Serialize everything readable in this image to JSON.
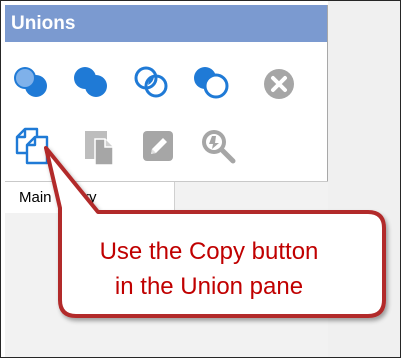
{
  "pane": {
    "title": "Unions",
    "row1_tools": [
      {
        "name": "union-icon",
        "color": "#1f7ad6"
      },
      {
        "name": "intersect-icon",
        "color": "#1f7ad6"
      },
      {
        "name": "union-outline-icon",
        "color": "#1f7ad6"
      },
      {
        "name": "exclude-icon",
        "color": "#1f7ad6"
      },
      {
        "name": "delete-icon",
        "color": "#9e9e9e"
      }
    ],
    "row2_tools": [
      {
        "name": "copy-icon",
        "color": "#1f7ad6"
      },
      {
        "name": "paste-icon",
        "color": "#a6a6a6"
      },
      {
        "name": "edit-icon",
        "color": "#a6a6a6"
      },
      {
        "name": "find-icon",
        "color": "#a6a6a6"
      }
    ]
  },
  "tab": {
    "label": "Main Query"
  },
  "callout": {
    "line1": "Use the Copy button",
    "line2": "in the Union pane",
    "border_color": "#b22b2b"
  }
}
